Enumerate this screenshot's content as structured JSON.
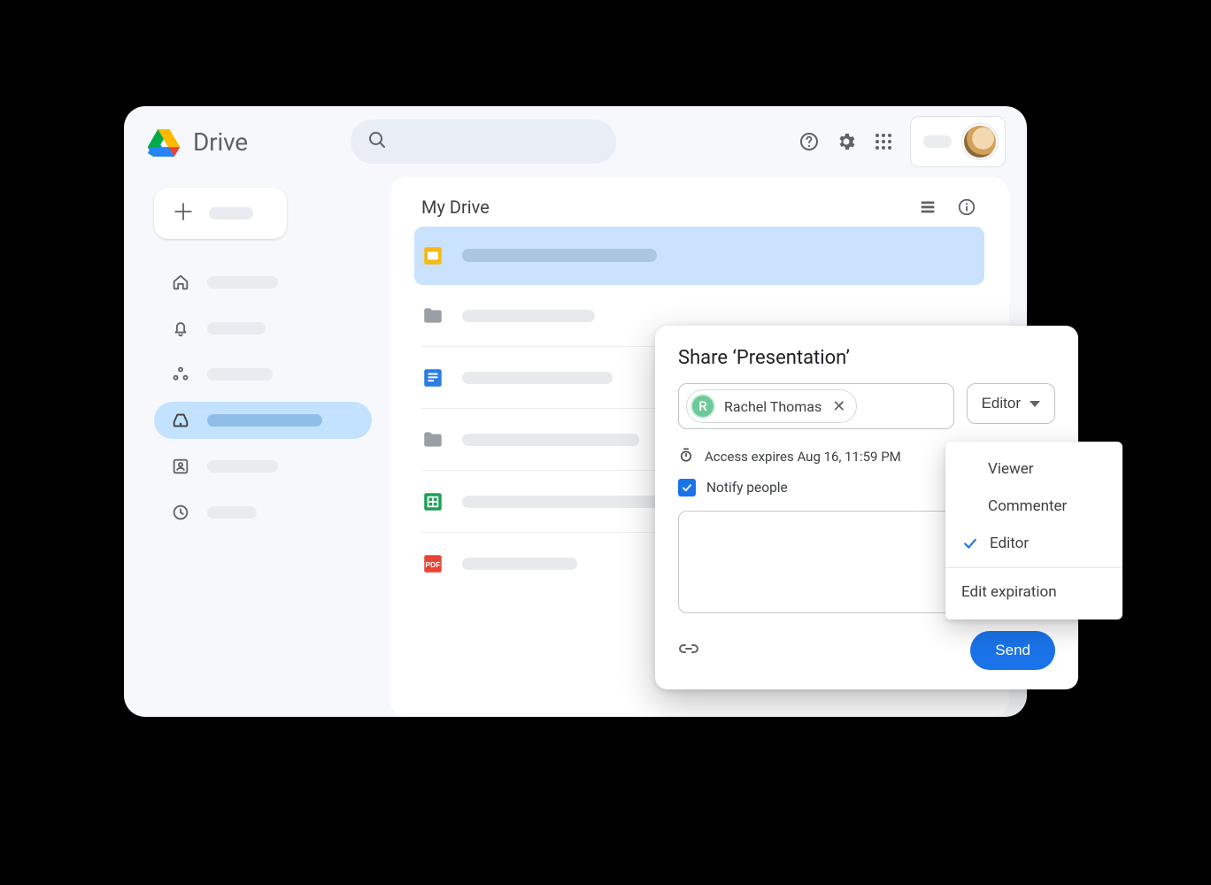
{
  "header": {
    "product": "Drive"
  },
  "sidebar": {
    "items": [
      "home",
      "activity",
      "shared",
      "storage",
      "contacts",
      "recent"
    ]
  },
  "main": {
    "title": "My Drive",
    "rows": [
      {
        "type": "slides",
        "selected": true
      },
      {
        "type": "folder"
      },
      {
        "type": "docs"
      },
      {
        "type": "folder"
      },
      {
        "type": "sheets"
      },
      {
        "type": "pdf"
      }
    ]
  },
  "share": {
    "title": "Share ‘Presentation’",
    "person_name": "Rachel Thomas",
    "person_initial": "R",
    "role_label": "Editor",
    "expires": "Access expires Aug 16, 11:59 PM",
    "notify_label": "Notify people",
    "send_label": "Send"
  },
  "role_menu": {
    "options": [
      "Viewer",
      "Commenter",
      "Editor"
    ],
    "selected": "Editor",
    "extra": "Edit expiration"
  }
}
